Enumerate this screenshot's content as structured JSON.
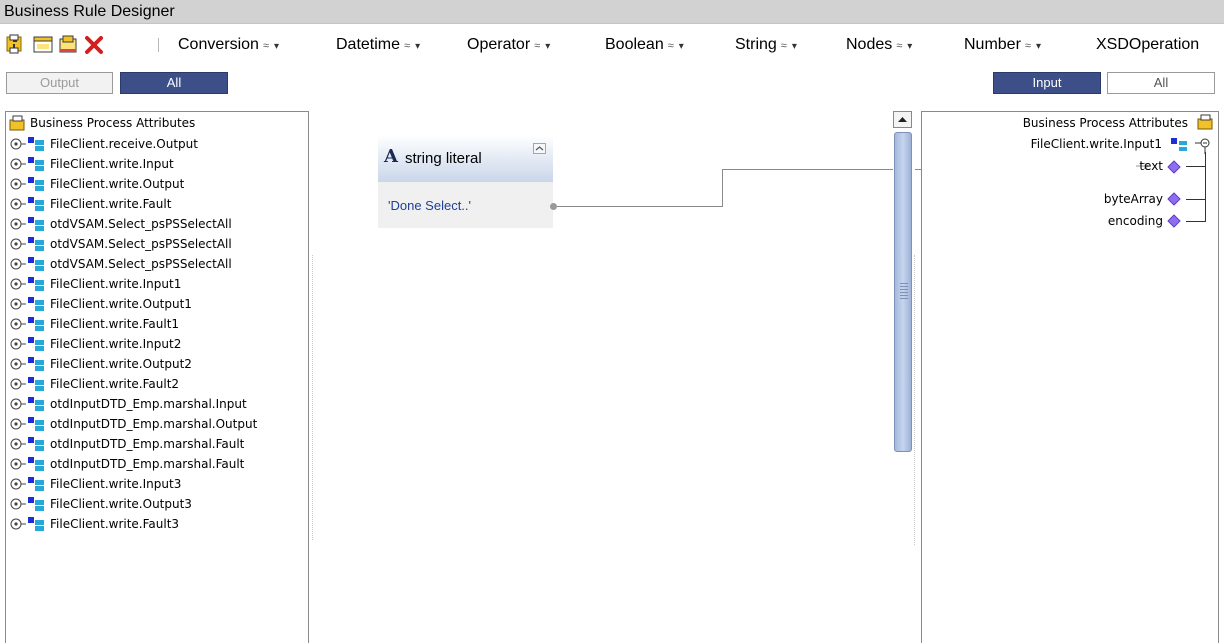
{
  "title": "Business Rule Designer",
  "toolbar": {
    "menus": [
      "Conversion",
      "Datetime",
      "Operator",
      "Boolean",
      "String",
      "Nodes",
      "Number",
      "XSDOperation"
    ]
  },
  "left_tabs": {
    "output": "Output",
    "all": "All"
  },
  "right_tabs": {
    "input": "Input",
    "all": "All"
  },
  "left_tree": {
    "root": "Business Process Attributes",
    "items": [
      "FileClient.receive.Output",
      "FileClient.write.Input",
      "FileClient.write.Output",
      "FileClient.write.Fault",
      "otdVSAM.Select_psPSSelectAll",
      "otdVSAM.Select_psPSSelectAll",
      "otdVSAM.Select_psPSSelectAll",
      "FileClient.write.Input1",
      "FileClient.write.Output1",
      "FileClient.write.Fault1",
      "FileClient.write.Input2",
      "FileClient.write.Output2",
      "FileClient.write.Fault2",
      "otdInputDTD_Emp.marshal.Input",
      "otdInputDTD_Emp.marshal.Output",
      "otdInputDTD_Emp.marshal.Fault",
      "otdInputDTD_Emp.marshal.Fault",
      "FileClient.write.Input3",
      "FileClient.write.Output3",
      "FileClient.write.Fault3"
    ]
  },
  "node": {
    "type": "string literal",
    "value": "'Done Select..'"
  },
  "right_tree": {
    "root": "Business Process Attributes",
    "parent": "FileClient.write.Input1",
    "children": [
      "text",
      "byteArray",
      "encoding"
    ]
  },
  "colors": {
    "accent": "#3c4f88",
    "link_value": "#1f3f98",
    "port": "#8f6cf0"
  }
}
